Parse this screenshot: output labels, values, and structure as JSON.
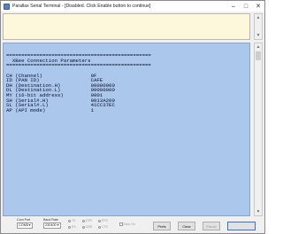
{
  "window": {
    "title": "Parallax Serial Terminal - [Disabled. Click Enable button to continue]",
    "controls": {
      "minimize": "–",
      "maximize": "□",
      "close": "✕"
    }
  },
  "transmit": {
    "text": ""
  },
  "receive": {
    "lines": [
      "",
      "",
      "================================================",
      "  XBee Connection Parameters",
      "================================================",
      "",
      "CH (Channel)                0F",
      "ID (PAN ID)                 CAFE",
      "DH (Destination.H)          00000000",
      "DL (Destination.L)          00000000",
      "MY (16-bit address)         0001",
      "SH (Serial#.H)              0013A200",
      "SL (Serial#.L)              41CC37EC",
      "AP (API mode)               1"
    ]
  },
  "statusbar": {
    "com_port_label": "Com Port",
    "com_port_value": "COM5",
    "baud_rate_label": "Baud Rate",
    "baud_rate_value": "230400",
    "indicators": {
      "tx": "TX",
      "rx": "RX",
      "dtr": "DTR",
      "dsr": "DSR",
      "rts": "RTS",
      "cts": "CTS"
    },
    "echo_on": "Echo On",
    "prefs_button": "Prefs",
    "clear_button": "Clear",
    "pause_button": "Pause",
    "enable_button": ""
  }
}
